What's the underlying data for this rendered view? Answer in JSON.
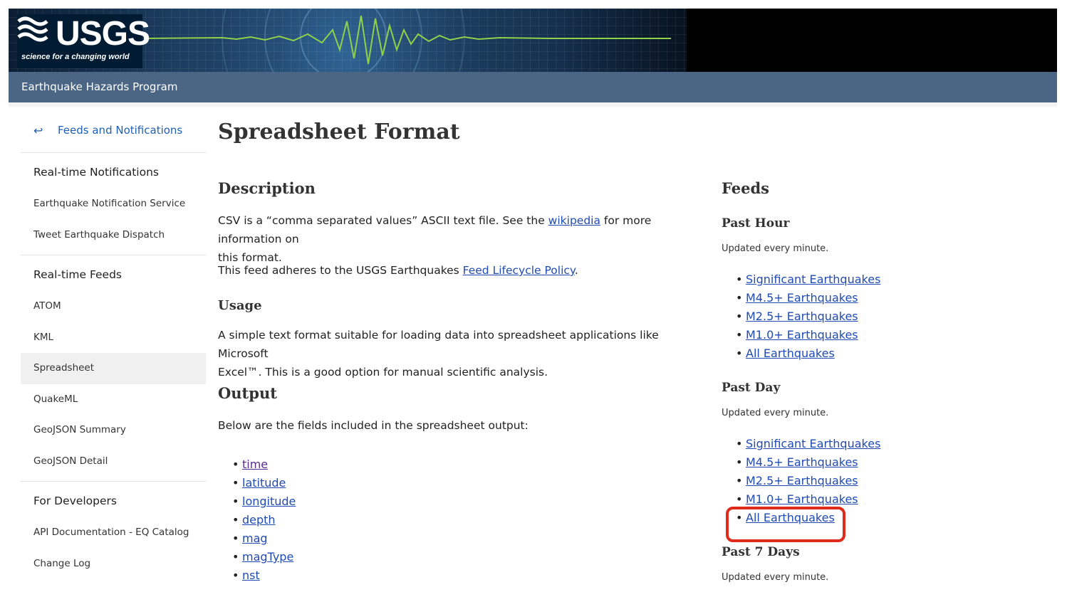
{
  "header": {
    "logo_text": "USGS",
    "logo_tagline": "science for a changing world",
    "program": "Earthquake Hazards Program"
  },
  "sidebar": {
    "back_label": "Feeds and Notifications",
    "back_icon": "return-arrow-icon",
    "sections": [
      {
        "title": "Real-time Notifications",
        "items": [
          "Earthquake Notification Service",
          "Tweet Earthquake Dispatch"
        ]
      },
      {
        "title": "Real-time Feeds",
        "items": [
          "ATOM",
          "KML",
          "Spreadsheet",
          "QuakeML",
          "GeoJSON Summary",
          "GeoJSON Detail"
        ],
        "active": "Spreadsheet"
      },
      {
        "title": "For Developers",
        "items": [
          "API Documentation - EQ Catalog",
          "Change Log"
        ]
      }
    ]
  },
  "main": {
    "title": "Spreadsheet Format",
    "description": {
      "heading": "Description",
      "p1_before": "CSV is a “comma separated values” ASCII text file. See the ",
      "p1_link": "wikipedia",
      "p1_after": " for more information on",
      "p1_line2": "this format.",
      "p2_before": "This feed adheres to the USGS Earthquakes ",
      "p2_link": "Feed Lifecycle Policy",
      "p2_after": "."
    },
    "usage": {
      "heading": "Usage",
      "line1": "A simple text format suitable for loading data into spreadsheet applications like Microsoft",
      "line2": "Excel™. This is a good option for manual scientific analysis."
    },
    "output": {
      "heading": "Output",
      "intro": "Below are the fields included in the spreadsheet output:",
      "fields": [
        "time",
        "latitude",
        "longitude",
        "depth",
        "mag",
        "magType",
        "nst"
      ]
    }
  },
  "feeds": {
    "heading": "Feeds",
    "groups": [
      {
        "title": "Past Hour",
        "updated": "Updated every minute.",
        "links": [
          "Significant Earthquakes",
          "M4.5+ Earthquakes",
          "M2.5+ Earthquakes",
          "M1.0+ Earthquakes",
          "All Earthquakes"
        ]
      },
      {
        "title": "Past Day",
        "updated": "Updated every minute.",
        "links": [
          "Significant Earthquakes",
          "M4.5+ Earthquakes",
          "M2.5+ Earthquakes",
          "M1.0+ Earthquakes",
          "All Earthquakes"
        ]
      },
      {
        "title": "Past 7 Days",
        "updated": "Updated every minute."
      }
    ]
  },
  "colors": {
    "program_bar": "#4a6684",
    "link": "#1f4bb3",
    "highlight": "#e02b1a"
  }
}
